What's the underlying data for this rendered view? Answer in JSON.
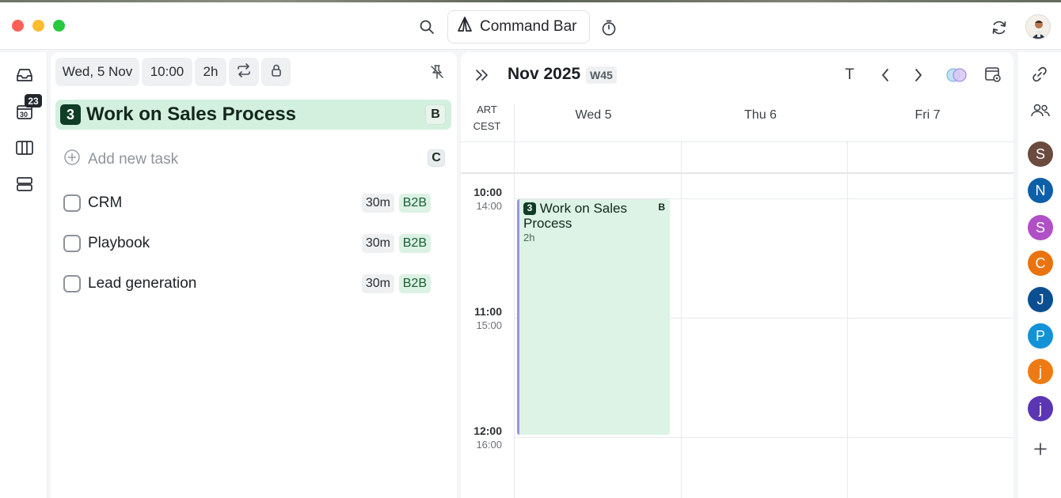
{
  "toolbar": {
    "command_bar_label": "Command Bar"
  },
  "rail": {
    "calendar_badge": "23",
    "calendar_date": "30"
  },
  "task_panel": {
    "date_chip": "Wed, 5 Nov",
    "time_chip": "10:00",
    "duration_chip": "2h",
    "selected_task": {
      "number": "3",
      "title": "Work on Sales Process",
      "shortcut": "B"
    },
    "add_task": {
      "placeholder": "Add new task",
      "shortcut": "C"
    },
    "tasks": [
      {
        "label": "CRM",
        "duration": "30m",
        "tag": "B2B"
      },
      {
        "label": "Playbook",
        "duration": "30m",
        "tag": "B2B"
      },
      {
        "label": "Lead generation",
        "duration": "30m",
        "tag": "B2B"
      }
    ]
  },
  "calendar": {
    "month_label": "Nov 2025",
    "week_label": "W45",
    "today_button": "T",
    "timezones": [
      "ART",
      "CEST"
    ],
    "days": [
      "Wed  5",
      "Thu  6",
      "Fri  7"
    ],
    "hours": [
      {
        "main": "10:00",
        "sub": "14:00"
      },
      {
        "main": "11:00",
        "sub": "15:00"
      },
      {
        "main": "12:00",
        "sub": "16:00"
      }
    ],
    "event": {
      "number": "3",
      "title": "Work on Sales Process",
      "duration": "2h",
      "shortcut": "B"
    }
  },
  "people": [
    {
      "initial": "S",
      "color": "#6b4b3e"
    },
    {
      "initial": "N",
      "color": "#0d5fa8"
    },
    {
      "initial": "S",
      "color": "#b04fc6"
    },
    {
      "initial": "C",
      "color": "#ea7310"
    },
    {
      "initial": "J",
      "color": "#0b4f90"
    },
    {
      "initial": "P",
      "color": "#1492d6"
    },
    {
      "initial": "j",
      "color": "#ee7a14"
    },
    {
      "initial": "j",
      "color": "#5b36b3"
    }
  ],
  "colors": {
    "accent_green": "#d3f0df",
    "badge_dark_green": "#0f3d26",
    "event_border": "#9b95d9"
  }
}
